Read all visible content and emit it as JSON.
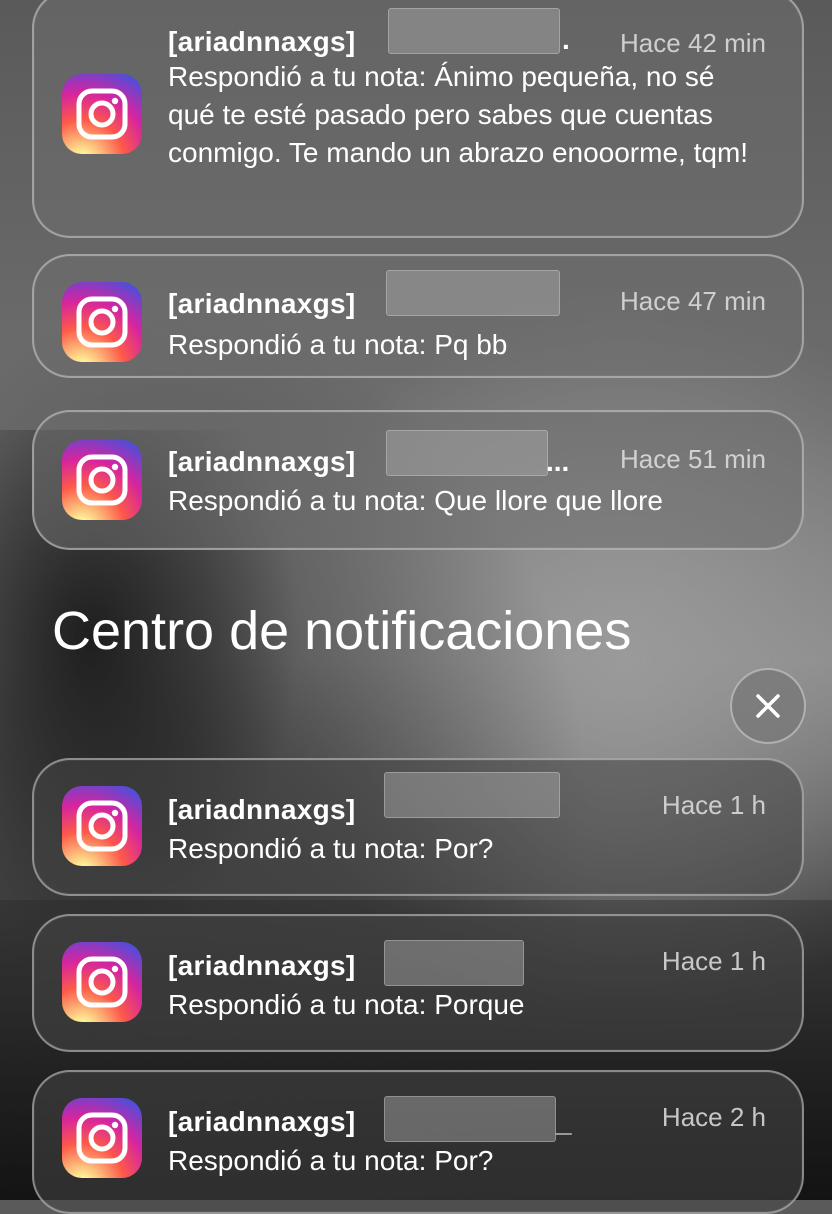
{
  "notifications_top": [
    {
      "title": "[ariadnnaxgs]",
      "suffix": ".",
      "time": "Hace 42 min",
      "body": "Respondió a tu nota: Ánimo pequeña, no sé qué te esté pasado pero sabes que cuentas conmigo. Te mando un abrazo enooorme, tqm!"
    },
    {
      "title": "[ariadnnaxgs]",
      "suffix": "",
      "time": "Hace 47 min",
      "body": "Respondió a tu nota: Pq bb"
    },
    {
      "title": "[ariadnnaxgs]",
      "suffix": "...",
      "time": "Hace 51 min",
      "body": "Respondió a tu nota: Que llore que llore"
    }
  ],
  "section": {
    "title": "Centro de notificaciones"
  },
  "close_icon": "close-icon",
  "notifications_center": [
    {
      "title": "[ariadnnaxgs]",
      "suffix": "",
      "time": "Hace 1 h",
      "body": "Respondió a tu nota: Por?"
    },
    {
      "title": "[ariadnnaxgs]",
      "suffix": "",
      "time": "Hace 1 h",
      "body": "Respondió a tu nota: Porque"
    },
    {
      "title": "[ariadnnaxgs]",
      "suffix": "_",
      "time": "Hace 2 h",
      "body": "Respondió a tu nota: Por?"
    }
  ],
  "app_icon": "instagram-icon"
}
